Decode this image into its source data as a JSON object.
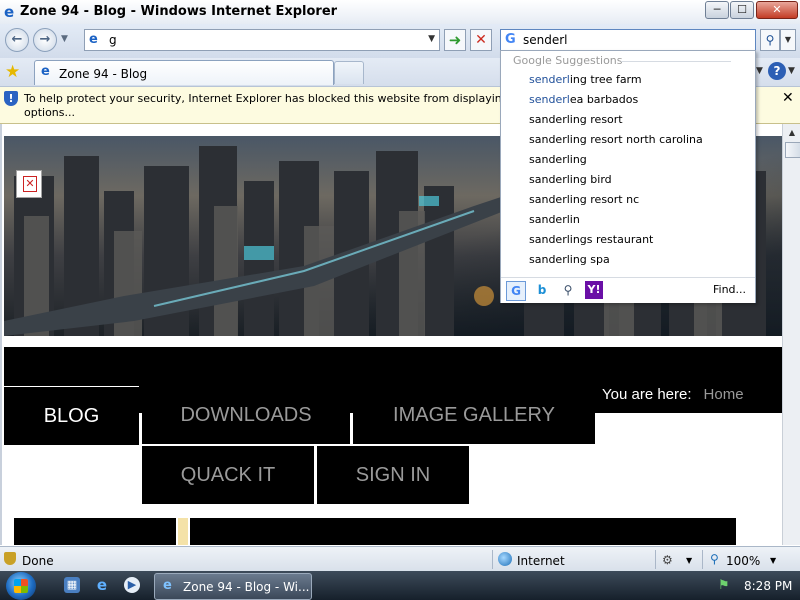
{
  "window": {
    "title": "Zone 94 - Blog - Windows Internet Explorer",
    "minimize_label": "─",
    "maximize_label": "☐",
    "close_label": "✕"
  },
  "address_bar": {
    "value": "g"
  },
  "search_box": {
    "value": "senderl"
  },
  "tabs": [
    {
      "label": "Zone 94 - Blog"
    }
  ],
  "info_bar": {
    "message": "To help protect your security, Internet Explorer has blocked this website from displaying cont",
    "message_line2": "options..."
  },
  "suggestions": {
    "header": "Google Suggestions",
    "items": [
      {
        "highlight": "senderl",
        "rest": "ing tree farm"
      },
      {
        "highlight": "senderl",
        "rest": "ea barbados"
      },
      {
        "highlight": "",
        "rest": "sanderling resort"
      },
      {
        "highlight": "",
        "rest": "sanderling resort north carolina"
      },
      {
        "highlight": "",
        "rest": "sanderling"
      },
      {
        "highlight": "",
        "rest": "sanderling bird"
      },
      {
        "highlight": "",
        "rest": "sanderling resort nc"
      },
      {
        "highlight": "",
        "rest": "sanderlin"
      },
      {
        "highlight": "",
        "rest": "sanderlings restaurant"
      },
      {
        "highlight": "",
        "rest": "sanderling spa"
      }
    ],
    "find_label": "Find...",
    "providers": [
      "google-icon",
      "bing-icon",
      "search-provider-icon",
      "yahoo-icon"
    ]
  },
  "site": {
    "breadcrumb_label": "You are here:",
    "breadcrumb_home": "Home",
    "menu": {
      "blog": "BLOG",
      "downloads": "DOWNLOADS",
      "gallery": "IMAGE GALLERY",
      "quack": "QUACK IT",
      "signin": "SIGN IN"
    },
    "accent_color": "#f4e2a8"
  },
  "status_bar": {
    "status": "Done",
    "zone": "Internet",
    "zoom": "100%"
  },
  "taskbar": {
    "task_label": "Zone 94 - Blog - Wi...",
    "clock": "8:28 PM"
  }
}
